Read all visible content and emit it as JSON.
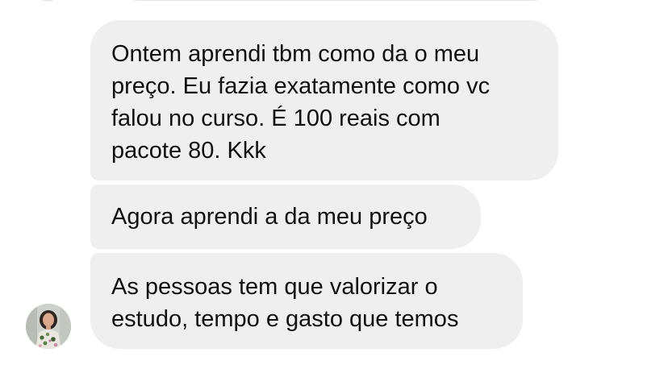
{
  "messages": [
    {
      "text": "Ontem aprendi tbm como da o meu\npreço. Eu fazia exatamente como vc\nfalou no curso. É 100 reais com\npacote 80. Kkk"
    },
    {
      "text": "Agora aprendi a da meu preço"
    },
    {
      "text": "As pessoas tem que valorizar o\nestudo, tempo e gasto que temos"
    }
  ],
  "colors": {
    "bubble_bg": "#efefef",
    "text": "#111111",
    "background": "#ffffff"
  },
  "icons": {
    "avatar": "sender-avatar"
  }
}
